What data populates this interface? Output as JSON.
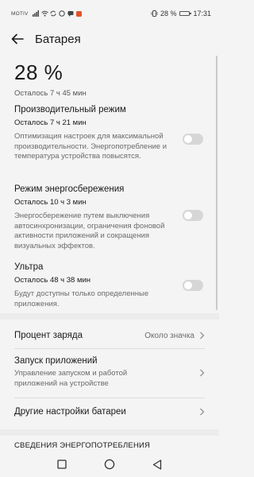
{
  "status_bar": {
    "carrier": "MOTIV",
    "battery_percent": "28 %",
    "battery_level": 0.28,
    "time": "17:31",
    "icons": [
      "signal-icon",
      "wifi-icon",
      "sync-icon",
      "whatsapp-icon",
      "message-icon",
      "app-icon"
    ]
  },
  "header": {
    "title": "Батарея",
    "back_icon": "arrow-left-icon"
  },
  "battery": {
    "percent": "28 %",
    "remaining": "Осталось 7 ч 45 мин"
  },
  "modes": [
    {
      "title": "Производительный режим",
      "remaining": "Осталось 7 ч 21 мин",
      "desc": "Оптимизация настроек для максимальной производительности. Энергопотребление и температура устройства повысятся.",
      "enabled": false
    },
    {
      "title": "Режим энергосбережения",
      "remaining": "Осталось 10 ч 3 мин",
      "desc": "Энергосбережение путем выключения автосинхронизации, ограничения фоновой активности приложений и сокращения визуальных эффектов.",
      "enabled": false
    },
    {
      "title": "Ультра",
      "remaining": "Осталось 48 ч 38 мин",
      "desc": "Будут доступны только определенные приложения.",
      "enabled": false
    }
  ],
  "settings": {
    "charge_percent": {
      "label": "Процент заряда",
      "value": "Около значка"
    },
    "app_launch": {
      "label": "Запуск приложений",
      "desc": "Управление запуском и работой приложений на устройстве"
    },
    "other": {
      "label": "Другие настройки батареи"
    }
  },
  "section_header": "СВЕДЕНИЯ ЭНЕРГОПОТРЕБЛЕНИЯ",
  "colors": {
    "background": "#f4f4f4",
    "toggle_off": "#d6d6d6",
    "secondary_text": "#6b6b6b"
  }
}
